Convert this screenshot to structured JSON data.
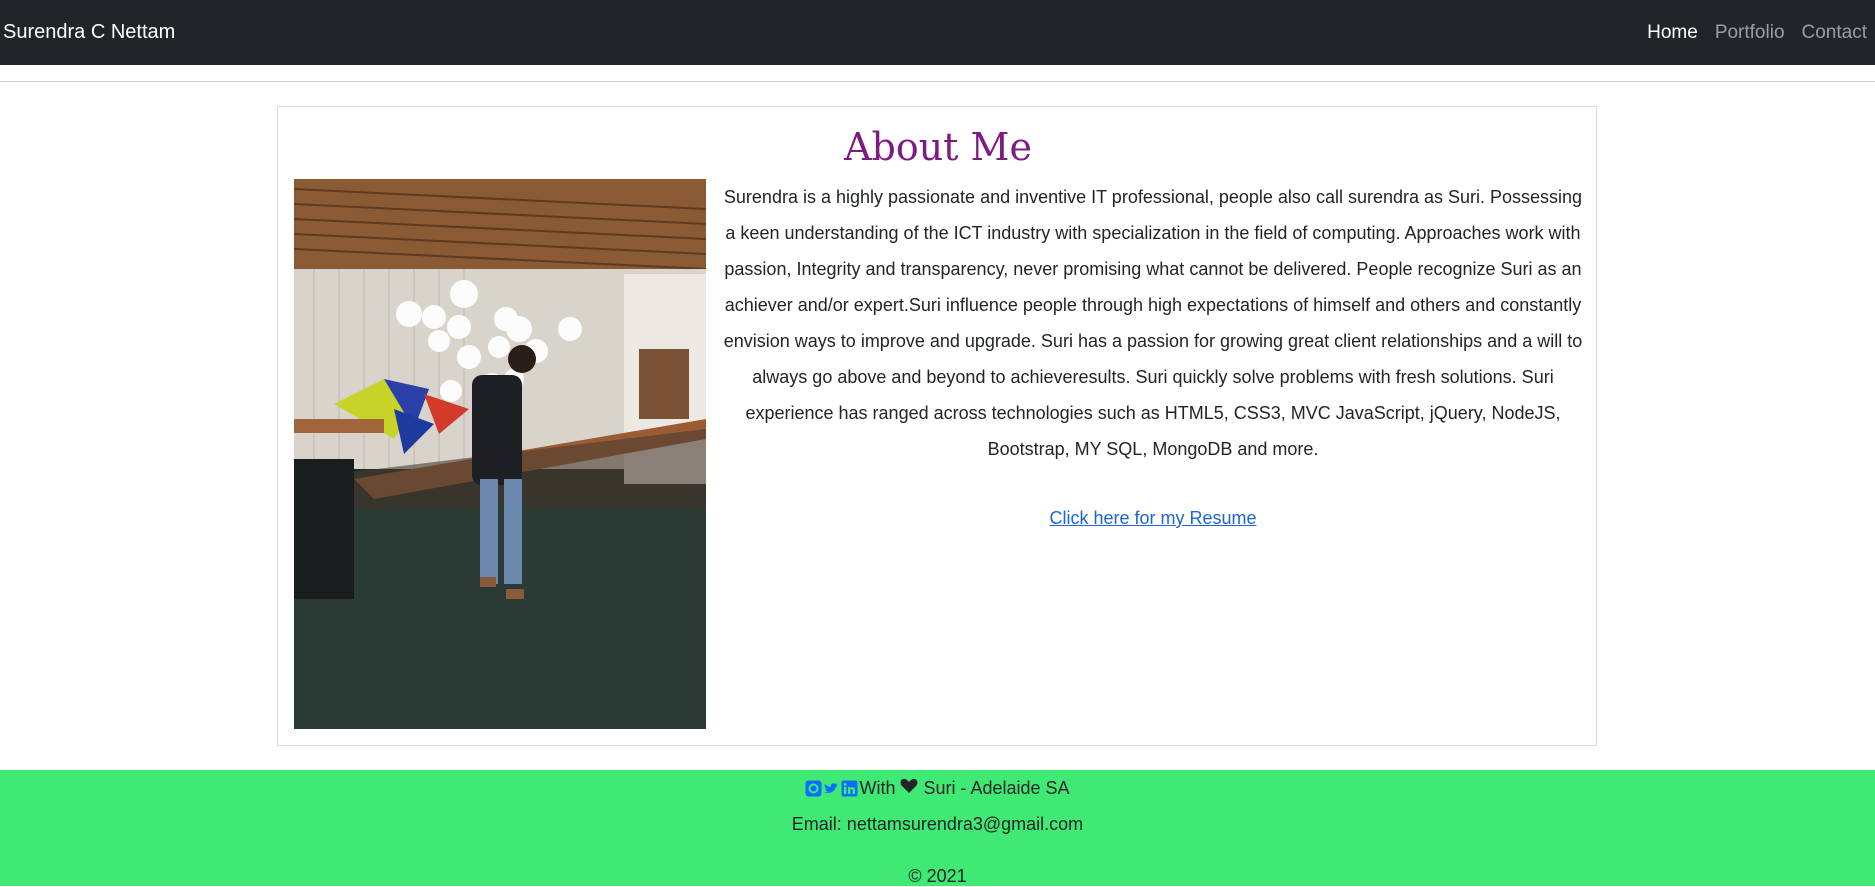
{
  "nav": {
    "brand": "Surendra C Nettam",
    "links": [
      "Home",
      "Portfolio",
      "Contact"
    ]
  },
  "about": {
    "title": "About Me",
    "bio": "Surendra is a highly passionate and inventive IT professional, people also call surendra as Suri. Possessing a keen understanding of the ICT industry with specialization in the field of computing. Approaches work with passion, Integrity and transparency, never promising what cannot be delivered. People recognize Suri as an achiever and/or expert.Suri influence people through high expectations of himself and others and constantly envision ways to improve and upgrade. Suri has a passion for growing great client relationships and a will to always go above and beyond to achieveresults. Suri quickly solve problems with fresh solutions. Suri experience has ranged across technologies such as HTML5, CSS3, MVC JavaScript, jQuery, NodeJS, Bootstrap, MY SQL, MongoDB and more.",
    "resume_link": "Click here for my Resume"
  },
  "footer": {
    "social_icons": [
      "github-icon",
      "twitter-icon",
      "linkedin-icon"
    ],
    "with_text": "With",
    "credit": "Suri - Adelaide SA",
    "email": "Email: nettamsurendra3@gmail.com",
    "copyright": "© 2021"
  },
  "colors": {
    "navbar_bg": "#212529",
    "title": "#7d1c80",
    "link": "#1a66d6",
    "footer_bg": "#3fe974",
    "social_icon": "#0d6efd"
  }
}
